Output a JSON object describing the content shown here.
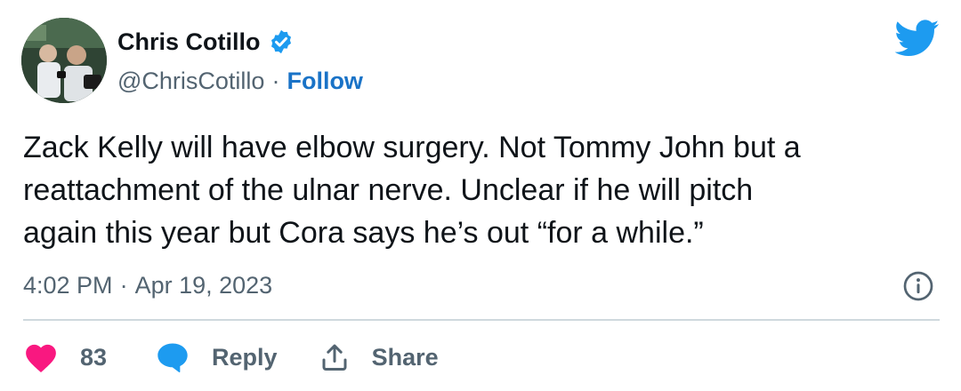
{
  "author": {
    "display_name": "Chris Cotillo",
    "handle": "@ChrisCotillo",
    "separator": "·",
    "follow_label": "Follow",
    "verified_icon": "verified-badge-icon",
    "avatar_icon": "avatar"
  },
  "brand": {
    "logo_icon": "twitter-bird-icon",
    "color": "#1d9bf0"
  },
  "tweet": {
    "text": "Zack Kelly will have elbow surgery. Not Tommy John but a\nreattachment of the ulnar nerve. Unclear if he will pitch\nagain this year but Cora says he’s out “for a while.”"
  },
  "meta": {
    "time": "4:02 PM",
    "separator": "·",
    "date": "Apr 19, 2023",
    "info_icon": "info-icon"
  },
  "actions": {
    "like_count": "83",
    "like_icon": "heart-icon",
    "like_color": "#f91880",
    "reply_label": "Reply",
    "reply_icon": "speech-bubble-icon",
    "reply_color": "#1d9bf0",
    "share_label": "Share",
    "share_icon": "share-upload-icon"
  }
}
